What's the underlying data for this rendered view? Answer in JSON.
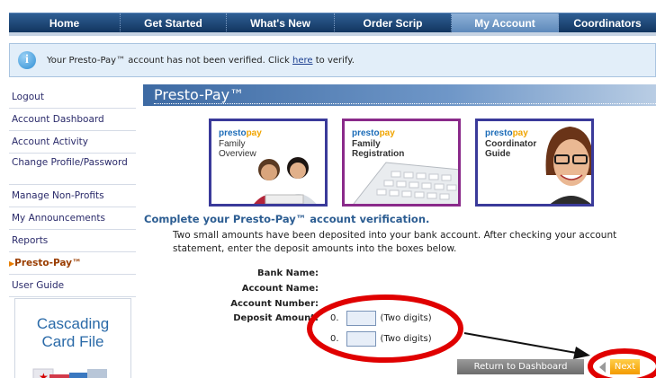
{
  "nav": {
    "items": [
      {
        "label": "Home"
      },
      {
        "label": "Get Started"
      },
      {
        "label": "What's New"
      },
      {
        "label": "Order Scrip"
      },
      {
        "label": "My Account",
        "active": true
      },
      {
        "label": "Coordinators"
      }
    ]
  },
  "alert": {
    "pre": "Your Presto-Pay™ account has not been verified. Click ",
    "link": "here",
    "post": " to verify."
  },
  "sidebar": {
    "items": [
      {
        "label": "Logout"
      },
      {
        "label": "Account Dashboard"
      },
      {
        "label": "Account Activity"
      },
      {
        "label": "Change Profile/Password"
      },
      {
        "label": "Manage Non-Profits"
      },
      {
        "label": "My Announcements"
      },
      {
        "label": "Reports"
      },
      {
        "label": "Presto-Pay™",
        "active": true
      },
      {
        "label": "User Guide"
      }
    ],
    "promo": {
      "line1": "Cascading",
      "line2": "Card File"
    }
  },
  "section": {
    "title": "Presto-Pay™"
  },
  "tiles": [
    {
      "brand_a": "presto",
      "brand_b": "pay",
      "caption": "Family Overview"
    },
    {
      "brand_a": "presto",
      "brand_b": "pay",
      "caption": "Family Registration"
    },
    {
      "brand_a": "presto",
      "brand_b": "pay",
      "caption": "Coordinator Guide"
    }
  ],
  "verification": {
    "title": "Complete your Presto-Pay™ account verification.",
    "intro": "Two small amounts have been deposited into your bank account. After checking your account statement, enter the deposit amounts into the boxes below."
  },
  "form": {
    "bank_name_label": "Bank Name:",
    "account_name_label": "Account Name:",
    "account_number_label": "Account Number:",
    "deposit_label": "Deposit Amount:",
    "deposit1_prefix": "0.",
    "deposit1_value": "",
    "deposit1_hint": "(Two digits)",
    "deposit2_prefix": "0.",
    "deposit2_value": "",
    "deposit2_hint": "(Two digits)"
  },
  "buttons": {
    "back": "Return to Dashboard",
    "next": "Next"
  },
  "colors": {
    "nav": "#12355f",
    "accent": "#f39a00",
    "annotation": "#e00000"
  }
}
